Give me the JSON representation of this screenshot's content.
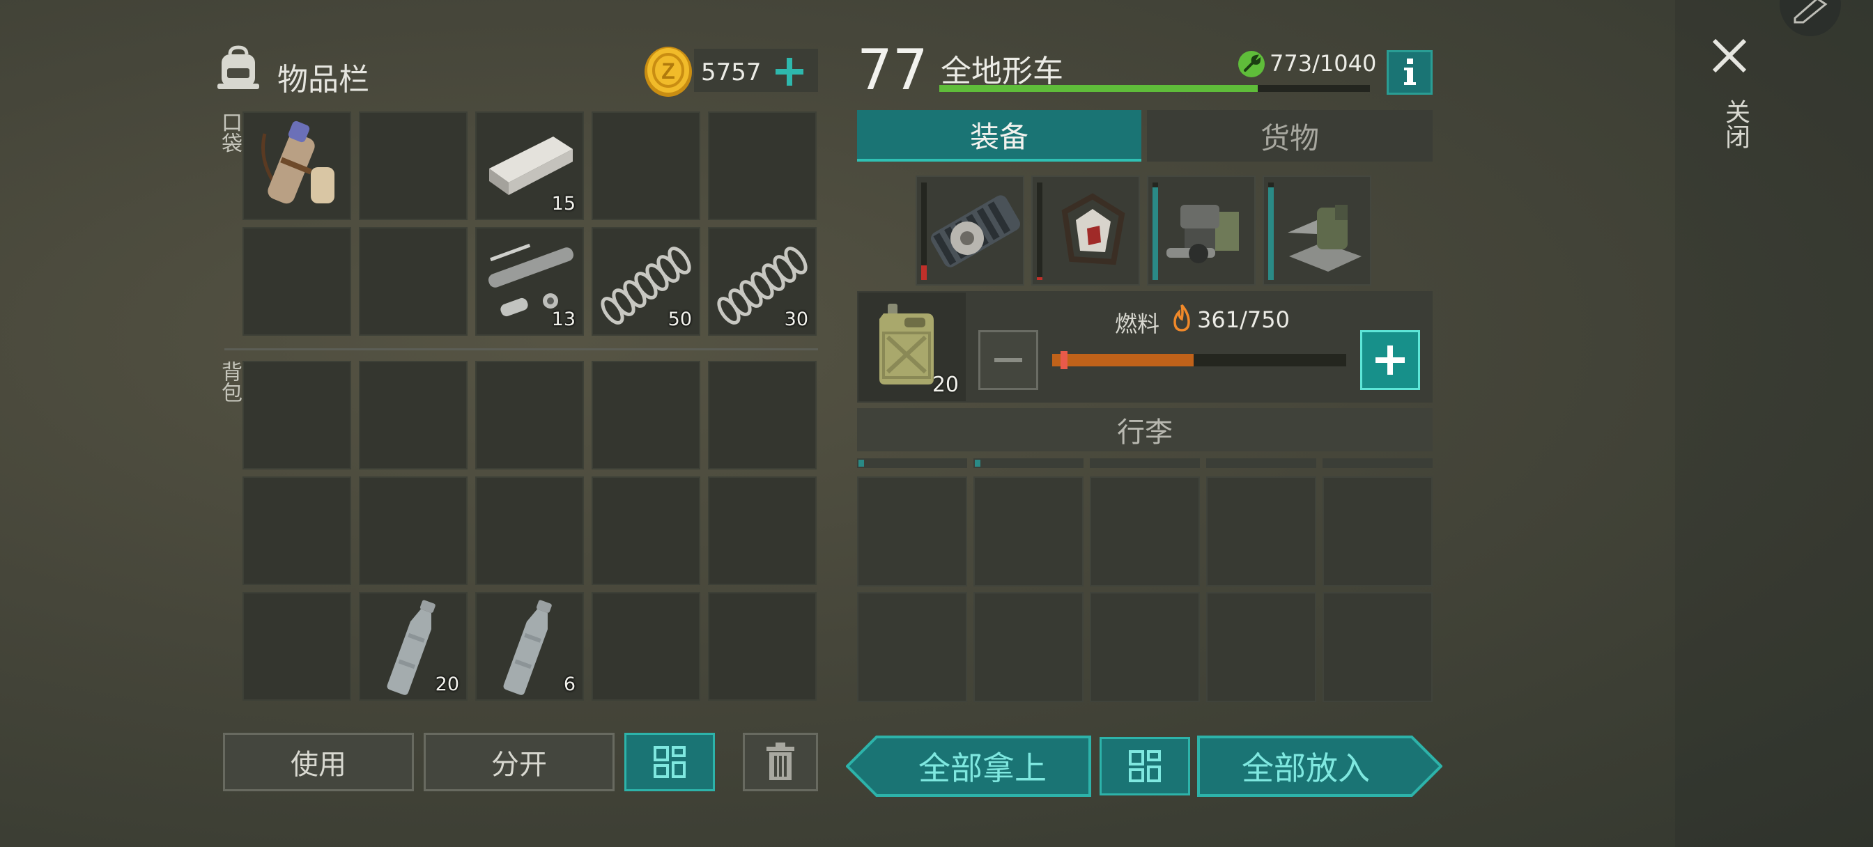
{
  "inventory": {
    "title": "物品栏",
    "currency": "5757",
    "pocket_label": "口袋",
    "backpack_label": "背包",
    "pocket_slots": [
      {
        "item": "bag",
        "count": ""
      },
      {
        "item": "",
        "count": ""
      },
      {
        "item": "ingot",
        "count": "15"
      },
      {
        "item": "",
        "count": ""
      },
      {
        "item": "",
        "count": ""
      },
      {
        "item": "",
        "count": ""
      },
      {
        "item": "",
        "count": ""
      },
      {
        "item": "pipe-parts",
        "count": "13"
      },
      {
        "item": "spring",
        "count": "50"
      },
      {
        "item": "spring",
        "count": "30"
      }
    ],
    "backpack_slots": [
      {
        "item": "",
        "count": ""
      },
      {
        "item": "",
        "count": ""
      },
      {
        "item": "",
        "count": ""
      },
      {
        "item": "",
        "count": ""
      },
      {
        "item": "",
        "count": ""
      },
      {
        "item": "",
        "count": ""
      },
      {
        "item": "",
        "count": ""
      },
      {
        "item": "",
        "count": ""
      },
      {
        "item": "",
        "count": ""
      },
      {
        "item": "",
        "count": ""
      },
      {
        "item": "",
        "count": ""
      },
      {
        "item": "bottle",
        "count": "20"
      },
      {
        "item": "bottle",
        "count": "6"
      },
      {
        "item": "",
        "count": ""
      },
      {
        "item": "",
        "count": ""
      }
    ],
    "use_label": "使用",
    "split_label": "分开"
  },
  "vehicle": {
    "level": "77",
    "name": "全地形车",
    "durability": "773/1040",
    "durability_fraction": 0.74,
    "tabs": [
      "装备",
      "货物"
    ],
    "active_tab": 0,
    "equipment_wear": [
      0.15,
      0.03,
      0.95,
      0.95
    ],
    "fuel_label": "燃料",
    "fuel_value": "361/750",
    "fuel_fraction": 0.48,
    "jerrycan_count": "20",
    "luggage_label": "行李",
    "take_all_label": "全部拿上",
    "put_all_label": "全部放入"
  },
  "close_label": "关闭",
  "colors": {
    "teal": "#1a7474",
    "teal_border": "#2db3aa",
    "green_bar": "#5fbd3a",
    "fuel_bar": "#c0621a",
    "wear_red": "#c0302a",
    "wear_teal": "#2a8a86"
  },
  "icons": {
    "backpack": "backpack-icon",
    "coin": "coin-icon",
    "wrench": "wrench-icon",
    "info": "info-icon",
    "close": "close-icon",
    "flame": "flame-icon",
    "grid": "grid-icon",
    "trash": "trash-icon"
  }
}
